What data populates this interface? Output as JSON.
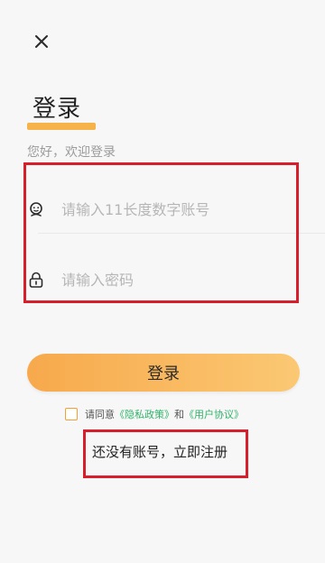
{
  "header": {
    "title": "登录",
    "subtitle": "您好，欢迎登录"
  },
  "form": {
    "account_placeholder": "请输入11长度数字账号",
    "password_placeholder": "请输入密码",
    "account_icon": "user-icon",
    "password_icon": "lock-icon"
  },
  "actions": {
    "login_label": "登录",
    "agreement": {
      "prefix": "请同意",
      "privacy_policy": "《隐私政策》",
      "and": "和",
      "user_agreement": "《用户协议》"
    },
    "register_label": "还没有账号，立即注册"
  },
  "colors": {
    "accent": "#f6b34a",
    "button_gradient_start": "#f7a94c",
    "button_gradient_end": "#fbc873",
    "link_green": "#31b36b",
    "highlight_red": "#d61f2a",
    "background": "#f7f7f7"
  }
}
